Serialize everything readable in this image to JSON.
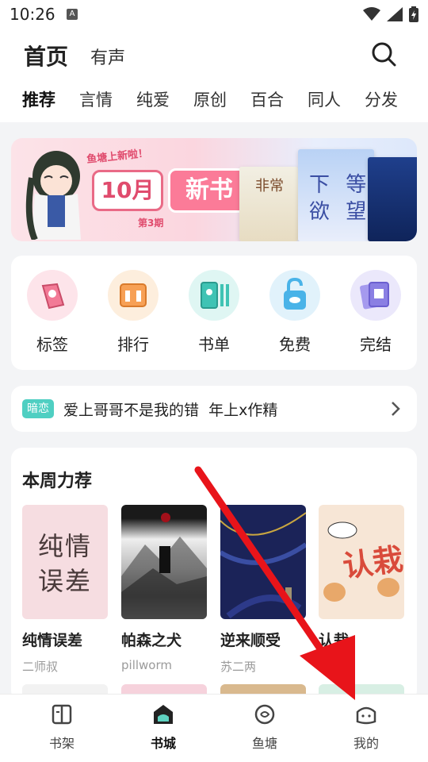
{
  "status_bar": {
    "time": "10:26",
    "notif_icon_letter": "A",
    "icons": [
      "wifi-icon",
      "signal-icon",
      "battery-icon"
    ]
  },
  "header": {
    "title": "首页",
    "subtitle": "有声"
  },
  "tabs": [
    {
      "label": "推荐",
      "active": true
    },
    {
      "label": "言情"
    },
    {
      "label": "纯爱"
    },
    {
      "label": "原创"
    },
    {
      "label": "百合"
    },
    {
      "label": "同人"
    },
    {
      "label": "分发"
    }
  ],
  "banner": {
    "badge": "鱼塘上新啦！",
    "month": "10月",
    "new_book": "新书",
    "issue": "第3期",
    "cover_texts": [
      "非常",
      "下 等\n欲 望"
    ]
  },
  "categories": [
    {
      "label": "标签",
      "icon": "tag-icon",
      "color": "#fde4ea",
      "accent": "#f27a96"
    },
    {
      "label": "排行",
      "icon": "ranking-icon",
      "color": "#fdeedd",
      "accent": "#f7a055"
    },
    {
      "label": "书单",
      "icon": "booklist-icon",
      "color": "#dff6f3",
      "accent": "#3fc3b4"
    },
    {
      "label": "免费",
      "icon": "free-icon",
      "color": "#e1f2fb",
      "accent": "#49b3e8"
    },
    {
      "label": "完结",
      "icon": "finished-icon",
      "color": "#ebe8fb",
      "accent": "#8a7fe3"
    }
  ],
  "recommend": {
    "badge": "暗恋",
    "text": "爱上哥哥不是我的错  年上x作精"
  },
  "weekly": {
    "title": "本周力荐",
    "books": [
      {
        "title": "纯情误差",
        "author": "二师叔",
        "cover_text": "纯情\n误差",
        "cover_color": "#f6dde1"
      },
      {
        "title": "帕森之犬",
        "author": "pillworm",
        "cover_text": "",
        "cover_color": "#d9d9d9"
      },
      {
        "title": "逆来顺受",
        "author": "苏二两",
        "cover_text": "",
        "cover_color": "#1b2358"
      },
      {
        "title": "认栽",
        "author": "棠",
        "cover_text": "认栽",
        "cover_color": "#f7e6d6"
      }
    ],
    "next_row_colors": [
      "#f2f2f2",
      "#f6d2dc",
      "#d9b98e",
      "#d8efe4"
    ]
  },
  "bottom_nav": [
    {
      "label": "书架",
      "icon": "bookshelf-icon"
    },
    {
      "label": "书城",
      "icon": "bookstore-icon",
      "active": true
    },
    {
      "label": "鱼塘",
      "icon": "fishpond-icon"
    },
    {
      "label": "我的",
      "icon": "profile-icon"
    }
  ],
  "annotation": {
    "arrow_color": "#e8141a"
  }
}
